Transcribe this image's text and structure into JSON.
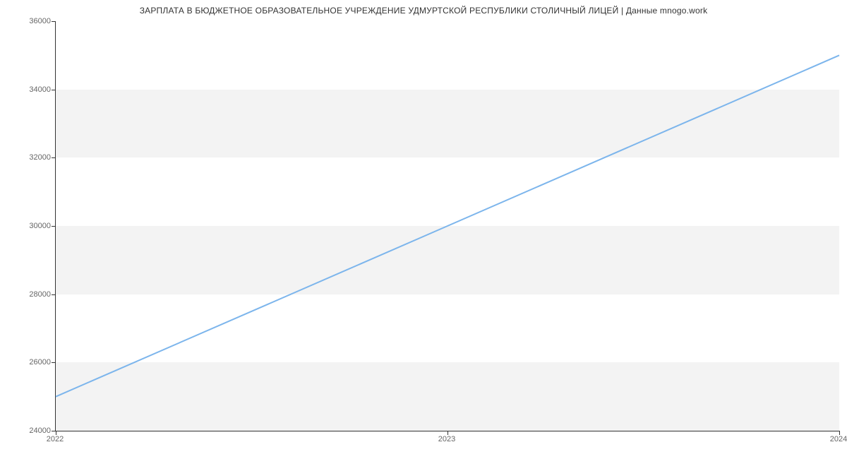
{
  "chart_data": {
    "type": "line",
    "title": "ЗАРПЛАТА В БЮДЖЕТНОЕ ОБРАЗОВАТЕЛЬНОЕ УЧРЕЖДЕНИЕ УДМУРТСКОЙ РЕСПУБЛИКИ  СТОЛИЧНЫЙ ЛИЦЕЙ | Данные mnogo.work",
    "xlabel": "",
    "ylabel": "",
    "x": [
      2022,
      2023,
      2024
    ],
    "values": [
      25000,
      30000,
      35000
    ],
    "x_ticks": [
      2022,
      2023,
      2024
    ],
    "y_ticks": [
      24000,
      26000,
      28000,
      30000,
      32000,
      34000,
      36000
    ],
    "ylim": [
      24000,
      36000
    ],
    "xlim": [
      2022,
      2024
    ],
    "line_color": "#7cb5ec"
  }
}
